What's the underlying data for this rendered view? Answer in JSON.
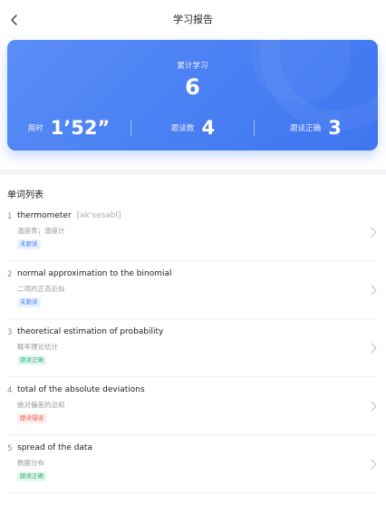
{
  "header": {
    "title": "学习报告"
  },
  "summary": {
    "total_label": "累计学习",
    "total_value": "6",
    "time_label": "用时",
    "time_value": "1’52”",
    "count_label": "跟读数",
    "count_value": "4",
    "correct_label": "跟读正确",
    "correct_value": "3",
    "card_color": "#4a80f3"
  },
  "word_list": {
    "title": "单词列表",
    "items": [
      {
        "index": "1",
        "word": "thermometer",
        "phonetic": "[ək'sesəbl]",
        "meaning": "温度表；温度计",
        "status": "未跟读",
        "status_color": "blue"
      },
      {
        "index": "2",
        "word": "normal approximation to the binomial",
        "phonetic": "",
        "meaning": "二项的正态近似",
        "status": "未跟读",
        "status_color": "blue"
      },
      {
        "index": "3",
        "word": "theoretical estimation of probability",
        "phonetic": "",
        "meaning": "概率理论估计",
        "status": "跟读正确",
        "status_color": "green"
      },
      {
        "index": "4",
        "word": "total of the absolute deviations",
        "phonetic": "",
        "meaning": "绝对偏差的总和",
        "status": "跟读错误",
        "status_color": "red"
      },
      {
        "index": "5",
        "word": "spread of the data",
        "phonetic": "",
        "meaning": "数据分布",
        "status": "跟读正确",
        "status_color": "green"
      }
    ]
  },
  "icons": {
    "back": "chevron-left-icon",
    "row_arrow": "chevron-right-icon"
  }
}
